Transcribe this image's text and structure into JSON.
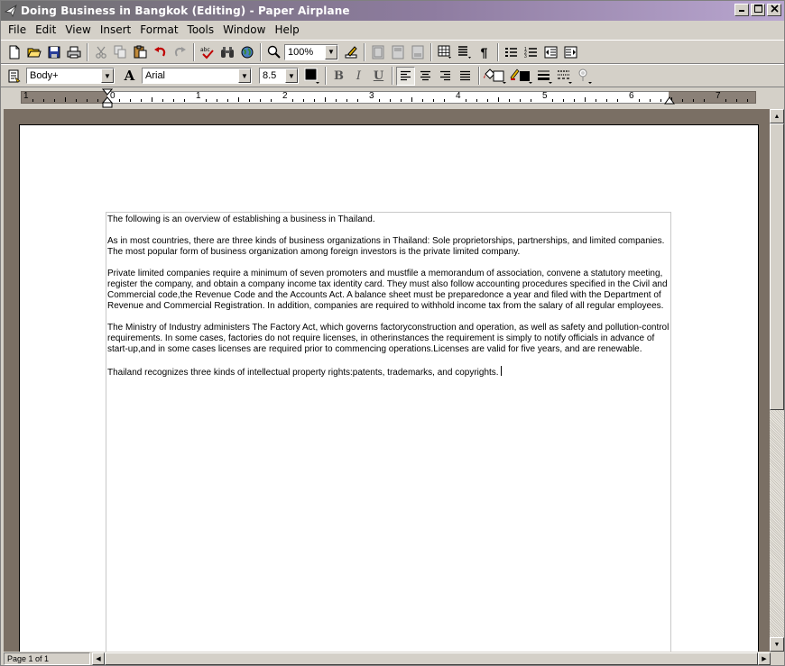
{
  "window": {
    "title": "Doing Business in Bangkok (Editing) - Paper Airplane",
    "controls": [
      "minimize",
      "maximize",
      "close"
    ]
  },
  "menu": [
    "File",
    "Edit",
    "View",
    "Insert",
    "Format",
    "Tools",
    "Window",
    "Help"
  ],
  "toolbar": {
    "zoom": "100%",
    "pilcrow": "¶"
  },
  "format_bar": {
    "style": "Body+",
    "font": "Arial",
    "size": "8.5",
    "bold": "B",
    "italic": "I",
    "underline": "U",
    "font_icon": "A"
  },
  "ruler": {
    "labels": [
      "1",
      "0",
      "1",
      "2",
      "3",
      "4",
      "5",
      "6",
      "7"
    ]
  },
  "document": {
    "paragraphs": [
      "The following is an overview of establishing a business in Thailand.",
      "As in most countries, there are three kinds of business organizations in Thailand: Sole proprietorships, partnerships, and limited companies. The most popular form of business organization among foreign investors is the private limited company.",
      "Private limited companies require a minimum of seven promoters and mustfile a memorandum of association, convene a statutory meeting, register the company, and obtain a company income tax identity card. They must also follow accounting procedures specified in the Civil and Commercial code,the Revenue Code and the Accounts Act. A balance sheet must be preparedonce a year and filed with the Department of Revenue and Commercial Registration. In addition, companies are required to withhold income tax from the salary of all regular employees.",
      "The Ministry of Industry administers The Factory Act, which governs factoryconstruction and operation, as well as safety and pollution-control requirements. In some cases, factories do not require licenses, in otherinstances the requirement is simply to notify officials in advance of start-up,and in some cases licenses are required prior to commencing operations.Licenses are valid for five years, and are renewable.",
      "Thailand recognizes three kinds of intellectual property rights:patents, trademarks, and copyrights."
    ]
  },
  "status": {
    "page": "Page 1 of 1"
  }
}
